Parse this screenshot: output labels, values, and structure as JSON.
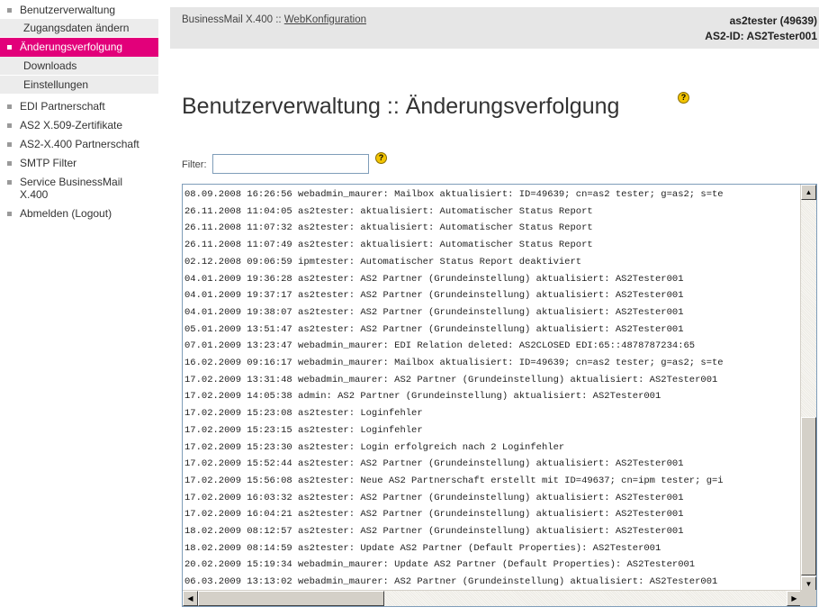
{
  "sidebar": {
    "items": [
      {
        "label": "Benutzerverwaltung"
      },
      {
        "label": "Zugangsdaten ändern"
      },
      {
        "label": "Änderungsverfolgung"
      },
      {
        "label": "Downloads"
      },
      {
        "label": "Einstellungen"
      },
      {
        "label": "EDI Partnerschaft"
      },
      {
        "label": "AS2 X.509-Zertifikate"
      },
      {
        "label": "AS2-X.400 Partnerschaft"
      },
      {
        "label": "SMTP Filter"
      },
      {
        "label": "Service BusinessMail X.400"
      },
      {
        "label": "Abmelden (Logout)"
      }
    ]
  },
  "header": {
    "crumb_prefix": "BusinessMail X.400 :: ",
    "crumb_link": "WebKonfiguration",
    "user": "as2tester (49639)",
    "as2id": "AS2-ID: AS2Tester001"
  },
  "main": {
    "title": "Benutzerverwaltung :: Änderungsverfolgung",
    "filter_label": "Filter:",
    "filter_value": "",
    "help_glyph": "?",
    "log": [
      "08.09.2008 16:26:56 webadmin_maurer: Mailbox aktualisiert: ID=49639; cn=as2 tester; g=as2; s=te",
      "26.11.2008 11:04:05 as2tester: aktualisiert: Automatischer Status Report",
      "26.11.2008 11:07:32 as2tester: aktualisiert: Automatischer Status Report",
      "26.11.2008 11:07:49 as2tester: aktualisiert: Automatischer Status Report",
      "02.12.2008 09:06:59 ipmtester: Automatischer Status Report deaktiviert",
      "04.01.2009 19:36:28 as2tester: AS2 Partner (Grundeinstellung) aktualisiert: AS2Tester001",
      "04.01.2009 19:37:17 as2tester: AS2 Partner (Grundeinstellung) aktualisiert: AS2Tester001",
      "04.01.2009 19:38:07 as2tester: AS2 Partner (Grundeinstellung) aktualisiert: AS2Tester001",
      "05.01.2009 13:51:47 as2tester: AS2 Partner (Grundeinstellung) aktualisiert: AS2Tester001",
      "07.01.2009 13:23:47 webadmin_maurer: EDI Relation deleted: AS2CLOSED EDI:65::4878787234:65",
      "16.02.2009 09:16:17 webadmin_maurer: Mailbox aktualisiert: ID=49639; cn=as2 tester; g=as2; s=te",
      "17.02.2009 13:31:48 webadmin_maurer: AS2 Partner (Grundeinstellung) aktualisiert: AS2Tester001",
      "17.02.2009 14:05:38 admin: AS2 Partner (Grundeinstellung) aktualisiert: AS2Tester001",
      "17.02.2009 15:23:08 as2tester: Loginfehler",
      "17.02.2009 15:23:15 as2tester: Loginfehler",
      "17.02.2009 15:23:30 as2tester: Login erfolgreich nach 2 Loginfehler",
      "17.02.2009 15:52:44 as2tester: AS2 Partner (Grundeinstellung) aktualisiert: AS2Tester001",
      "17.02.2009 15:56:08 as2tester: Neue AS2 Partnerschaft erstellt mit ID=49637; cn=ipm tester; g=i",
      "17.02.2009 16:03:32 as2tester: AS2 Partner (Grundeinstellung) aktualisiert: AS2Tester001",
      "17.02.2009 16:04:21 as2tester: AS2 Partner (Grundeinstellung) aktualisiert: AS2Tester001",
      "18.02.2009 08:12:57 as2tester: AS2 Partner (Grundeinstellung) aktualisiert: AS2Tester001",
      "18.02.2009 08:14:59 as2tester: Update AS2 Partner (Default Properties): AS2Tester001",
      "20.02.2009 15:19:34 webadmin_maurer: Update AS2 Partner (Default Properties): AS2Tester001",
      "06.03.2009 13:13:02 webadmin_maurer: AS2 Partner (Grundeinstellung) aktualisiert: AS2Tester001"
    ]
  },
  "colors": {
    "active_nav": "#e2007a",
    "sub_nav": "#ececec",
    "header_bg": "#e6e6e6"
  },
  "icons": {
    "nav_bullet": "square-bullet-icon",
    "help": "help-icon",
    "scroll_up": "arrow-up-icon",
    "scroll_down": "arrow-down-icon",
    "scroll_left": "arrow-left-icon",
    "scroll_right": "arrow-right-icon"
  }
}
